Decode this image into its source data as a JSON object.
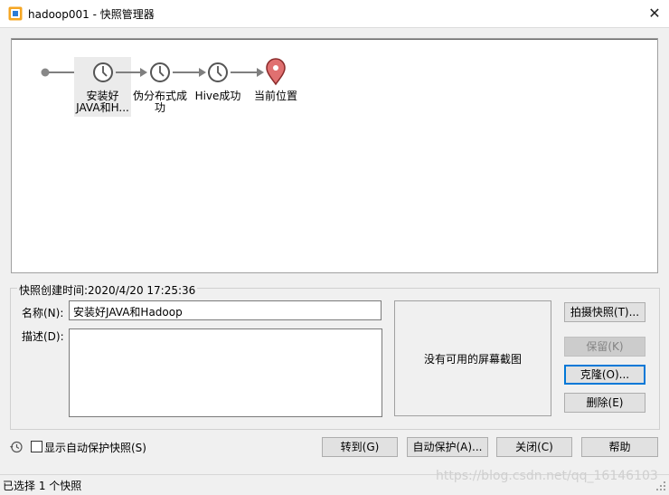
{
  "window": {
    "title": "hadoop001 - 快照管理器",
    "close_glyph": "✕"
  },
  "snapshots": [
    {
      "label_lines": [
        "安装好",
        "JAVA和H..."
      ],
      "icon": "clock-icon",
      "selected": true
    },
    {
      "label_lines": [
        "伪分布式成",
        "功"
      ],
      "icon": "clock-icon",
      "selected": false
    },
    {
      "label_lines": [
        "Hive成功"
      ],
      "icon": "clock-icon",
      "selected": false
    },
    {
      "label_lines": [
        "当前位置"
      ],
      "icon": "location-pin-icon",
      "selected": false
    }
  ],
  "details": {
    "created_label": "快照创建时间:2020/4/20 17:25:36",
    "name_label": "名称(N):",
    "name_value": "安装好JAVA和Hadoop",
    "desc_label": "描述(D):",
    "desc_value": "",
    "screenshot_placeholder": "没有可用的屏幕截图"
  },
  "side_buttons": {
    "take_snapshot": "拍摄快照(T)...",
    "keep": "保留(K)",
    "clone": "克隆(O)...",
    "delete": "删除(E)"
  },
  "bottom": {
    "show_auto_label": "显示自动保护快照(S)",
    "goto": "转到(G)",
    "autoprotect": "自动保护(A)...",
    "close": "关闭(C)",
    "help": "帮助"
  },
  "status": {
    "text": "已选择 1 个快照",
    "watermark": "https://blog.csdn.net/qq_16146103"
  },
  "colors": {
    "selected_bg": "#ebebeb",
    "connector": "#7f7f7f",
    "pin": "#e07070",
    "focus": "#0078d7"
  }
}
